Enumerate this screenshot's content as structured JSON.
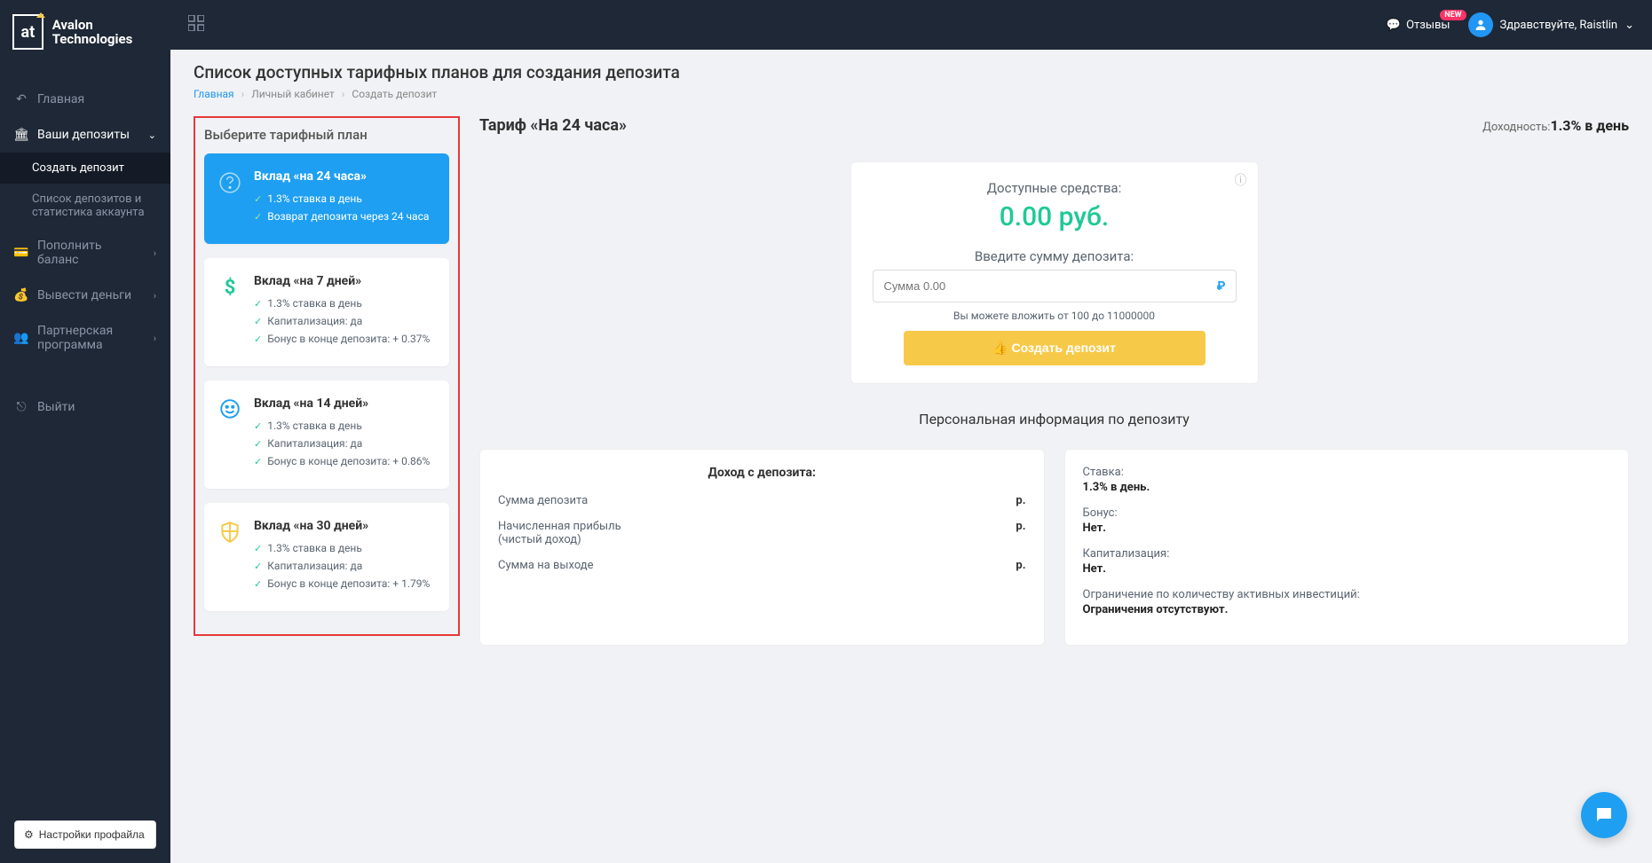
{
  "brand": {
    "name": "Avalon Technologies",
    "logo_text": "at"
  },
  "topbar": {
    "reviews_label": "Отзывы",
    "reviews_badge": "NEW",
    "greeting": "Здравствуйте, Raistlin"
  },
  "sidebar": {
    "items": [
      {
        "label": "Главная"
      },
      {
        "label": "Ваши депозиты"
      },
      {
        "label": "Пополнить баланс"
      },
      {
        "label": "Вывести деньги"
      },
      {
        "label": "Партнерская программа"
      },
      {
        "label": "Выйти"
      }
    ],
    "deposits_sub": [
      {
        "label": "Создать депозит"
      },
      {
        "label": "Список депозитов и статистика аккаунта"
      }
    ],
    "settings_label": "Настройки профайла"
  },
  "page": {
    "title": "Список доступных тарифных планов для создания депозита",
    "breadcrumb": {
      "home": "Главная",
      "lk": "Личный кабинет",
      "current": "Создать депозит"
    }
  },
  "tariff_panel": {
    "heading": "Выберите тарифный план",
    "plans": [
      {
        "title": "Вклад «на 24 часа»",
        "f1": "1.3% ставка в день",
        "f2": "Возврат депозита через 24 часа"
      },
      {
        "title": "Вклад «на 7 дней»",
        "f1": "1.3% ставка в день",
        "f2": "Капитализация: да",
        "f3": "Бонус в конце депозита: + 0.37%"
      },
      {
        "title": "Вклад «на 14 дней»",
        "f1": "1.3% ставка в день",
        "f2": "Капитализация: да",
        "f3": "Бонус в конце депозита: + 0.86%"
      },
      {
        "title": "Вклад «на 30 дней»",
        "f1": "1.3% ставка в день",
        "f2": "Капитализация: да",
        "f3": "Бонус в конце депозита: + 1.79%"
      }
    ]
  },
  "right": {
    "tariff_name": "Тариф «На 24 часа»",
    "yield_label": "Доходность:",
    "yield_value": "1.3% в день",
    "deposit_box": {
      "available_label": "Доступные средства:",
      "balance": "0.00 руб.",
      "enter_label": "Введите сумму депозита:",
      "placeholder": "Сумма 0.00",
      "currency": "₽",
      "hint": "Вы можете вложить от 100 до 11000000",
      "create_btn": "Создать депозит"
    },
    "personal_title": "Персональная информация по депозиту",
    "income_card": {
      "title": "Доход с депозита:",
      "rows": [
        {
          "k": "Сумма депозита",
          "v": "р."
        },
        {
          "k": "Начисленная прибыль (чистый доход)",
          "v": "р."
        },
        {
          "k": "Сумма на выходе",
          "v": "р."
        }
      ]
    },
    "params_card": {
      "rate_k": "Ставка:",
      "rate_v": "1.3% в день.",
      "bonus_k": "Бонус:",
      "bonus_v": "Нет.",
      "cap_k": "Капитализация:",
      "cap_v": "Нет.",
      "limit_k": "Ограничение по количеству активных инвестиций:",
      "limit_v": "Ограничения отсутствуют."
    }
  }
}
